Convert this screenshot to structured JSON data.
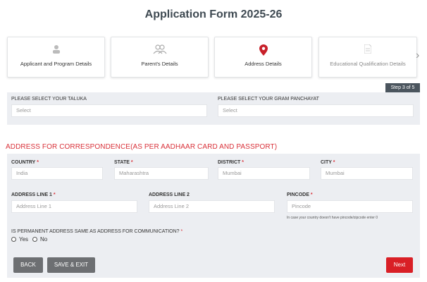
{
  "form": {
    "title": "Application Form 2025-26"
  },
  "steps": [
    {
      "label": "Applicant and Program Details",
      "icon": "user-icon"
    },
    {
      "label": "Parent's Details",
      "icon": "users-icon"
    },
    {
      "label": "Address Details",
      "icon": "map-pin-icon"
    },
    {
      "label": "Educational Qualification Details",
      "icon": "document-icon"
    }
  ],
  "step_indicator": "Step 3 of 5",
  "location": {
    "taluka_label": "PLEASE SELECT YOUR TALUKA",
    "taluka_value": "Select",
    "gram_label": "PLEASE SELECT YOUR GRAM PANCHAYAT",
    "gram_value": "Select"
  },
  "address_section": {
    "title": "ADDRESS FOR CORRESPONDENCE(AS PER AADHAAR CARD AND PASSPORT)",
    "country_label": "COUNTRY",
    "country_value": "India",
    "state_label": "STATE",
    "state_value": "Maharashtra",
    "district_label": "DISTRICT",
    "district_value": "Mumbai",
    "city_label": "CITY",
    "city_value": "Mumbai",
    "line1_label": "ADDRESS LINE 1",
    "line1_placeholder": "Address Line 1",
    "line2_label": "ADDRESS LINE 2",
    "line2_placeholder": "Address Line 2",
    "pincode_label": "PINCODE",
    "pincode_placeholder": "Pincode",
    "pincode_hint": "In case your country doesn't have pincode/zipcode enter 0",
    "permanent_question": "IS PERMANENT ADDRESS SAME AS ADDRESS FOR COMMUNICATION?",
    "yes_label": "Yes",
    "no_label": "No",
    "required_mark": "*"
  },
  "buttons": {
    "back": "BACK",
    "save_exit": "SAVE & EXIT",
    "next": "Next"
  },
  "colors": {
    "accent": "#d91f26",
    "panel": "#eceef2",
    "button_gray": "#6d6f72"
  }
}
